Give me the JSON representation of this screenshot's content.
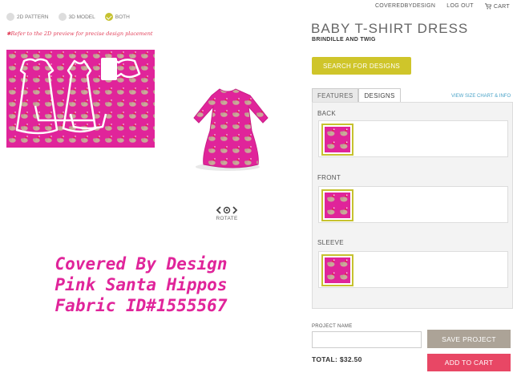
{
  "top_nav": {
    "account": "COVEREDBYDESIGN",
    "logout": "LOG OUT",
    "cart": "CART"
  },
  "view_options": [
    {
      "label": "2D PATTERN",
      "selected": false
    },
    {
      "label": "3D MODEL",
      "selected": false
    },
    {
      "label": "BOTH",
      "selected": true
    }
  ],
  "note": "✱Refer to the 2D preview for precise design placement",
  "rotate_label": "ROTATE",
  "caption_lines": [
    "Covered By Design",
    "Pink Santa Hippos",
    "Fabric ID#1555567"
  ],
  "product": {
    "title": "BABY T-SHIRT DRESS",
    "subtitle": "BRINDILLE AND TWIG"
  },
  "search_button": "SEARCH FOR DESIGNS",
  "tabs": [
    {
      "label": "FEATURES",
      "active": false
    },
    {
      "label": "DESIGNS",
      "active": true
    }
  ],
  "size_chart_link": "VIEW SIZE CHART & INFO",
  "sections": [
    {
      "label": "BACK"
    },
    {
      "label": "FRONT"
    },
    {
      "label": "SLEEVE"
    }
  ],
  "project_name": {
    "label": "PROJECT NAME",
    "value": "",
    "placeholder": ""
  },
  "save_button": "SAVE PROJECT",
  "total": "TOTAL: $32.50",
  "add_to_cart": "ADD TO CART",
  "colors": {
    "fabric_pink": "#e0249a",
    "accent_yellow": "#cfc52a",
    "cart_red": "#e84765",
    "link_blue": "#4aa3c8"
  }
}
